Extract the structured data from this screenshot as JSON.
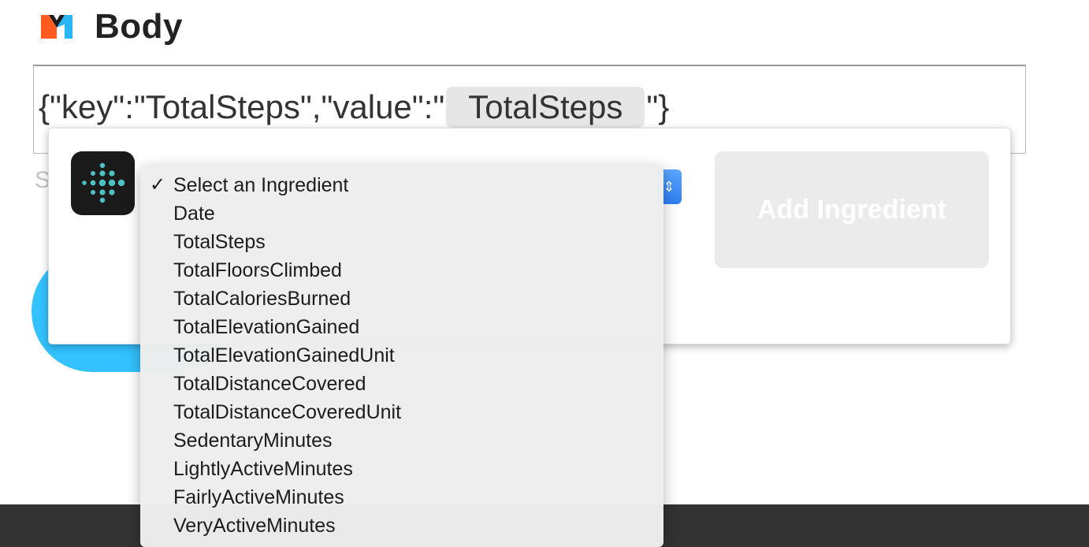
{
  "header": {
    "title": "Body",
    "logo_icon": "maker-logo-icon"
  },
  "body_field": {
    "prefix": "{\"key\":\"TotalSteps\",\"value\":\"",
    "ingredient": "TotalSteps",
    "suffix": "\"}"
  },
  "behind": {
    "partial_letter": "S"
  },
  "popover": {
    "service_icon": "fitbit-icon",
    "add_button_label": "Add Ingredient"
  },
  "dropdown": {
    "selected_index": 0,
    "check_mark": "✓",
    "options": [
      "Select an Ingredient",
      "Date",
      "TotalSteps",
      "TotalFloorsClimbed",
      "TotalCaloriesBurned",
      "TotalElevationGained",
      "TotalElevationGainedUnit",
      "TotalDistanceCovered",
      "TotalDistanceCoveredUnit",
      "SedentaryMinutes",
      "LightlyActiveMinutes",
      "FairlyActiveMinutes",
      "VeryActiveMinutes"
    ]
  },
  "colors": {
    "accent_blue": "#33c2ff",
    "footer": "#333333",
    "add_button_disabled": "#ebebeb",
    "logo_orange": "#ff5a1f",
    "logo_blue": "#29b6f6"
  }
}
